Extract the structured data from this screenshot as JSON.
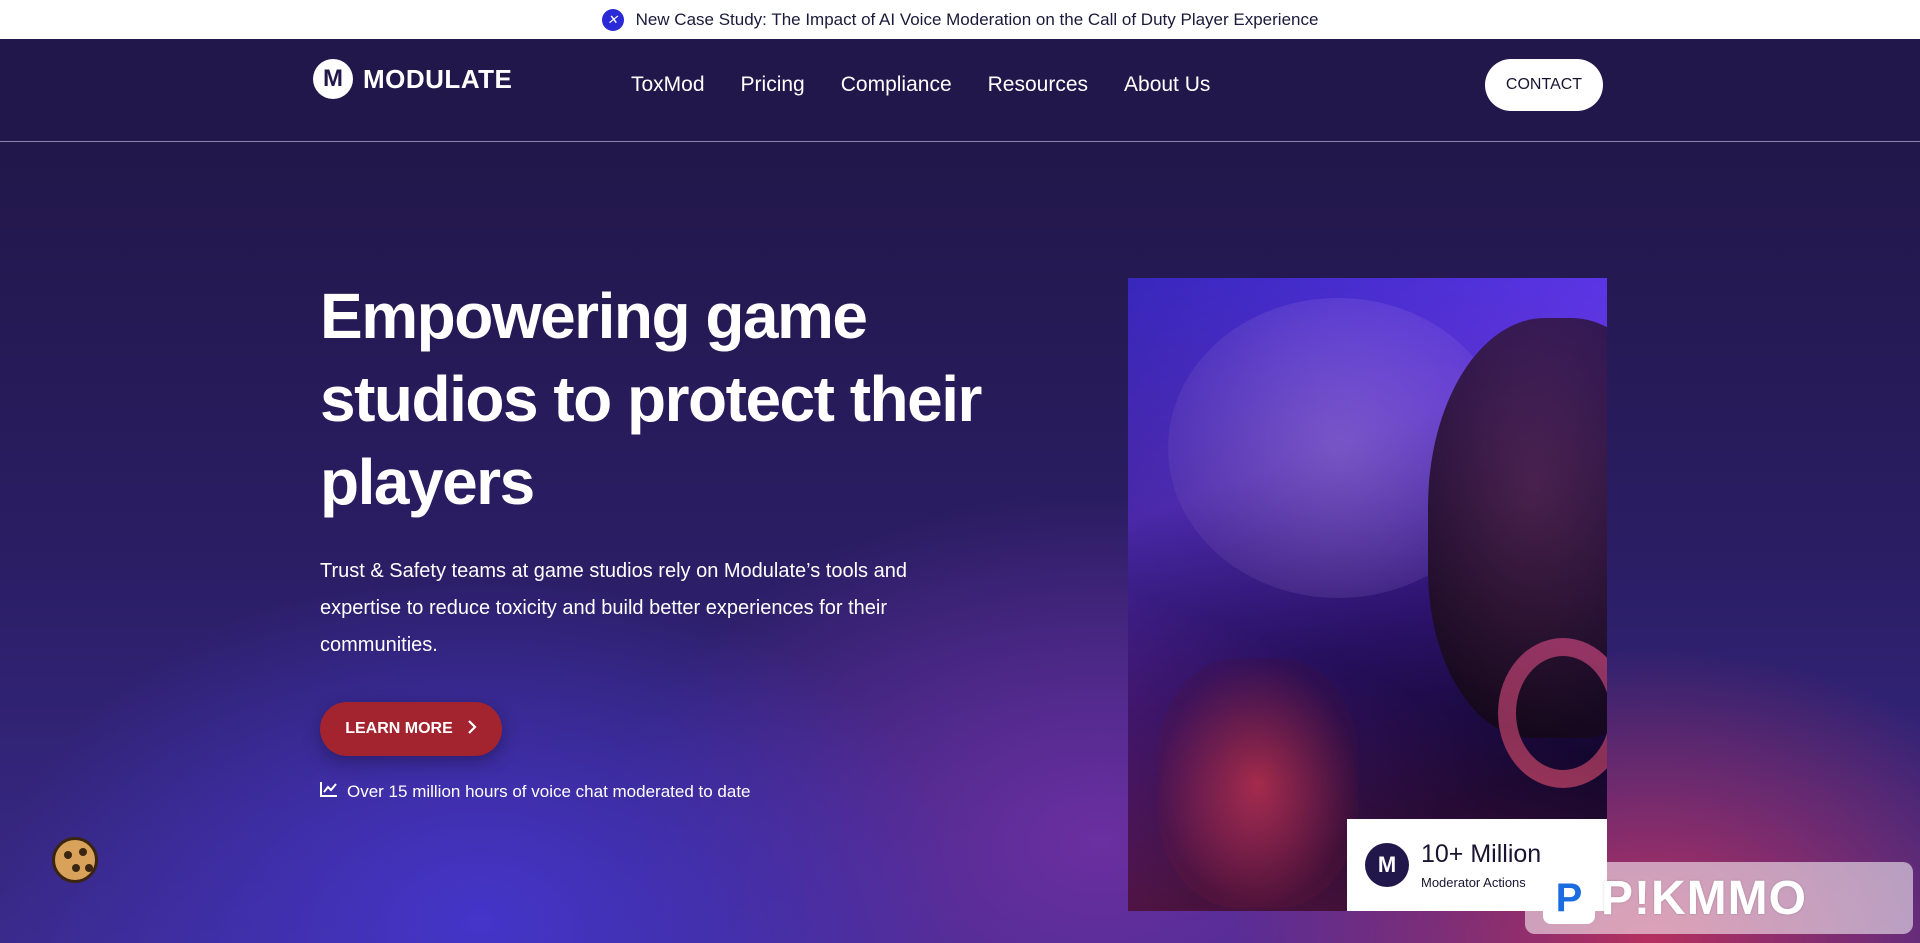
{
  "announcement": {
    "badge_icon": "x-circle-icon",
    "text": "New Case Study: The Impact of AI Voice Moderation on the Call of Duty Player Experience"
  },
  "nav": {
    "logo_text": "MODULATE",
    "logo_mark": "M",
    "items": [
      "ToxMod",
      "Pricing",
      "Compliance",
      "Resources",
      "About Us"
    ],
    "contact_label": "CONTACT"
  },
  "hero": {
    "headline": "Empowering game studios to protect their players",
    "subtext": "Trust & Safety teams at game studios rely on Modulate’s tools and expertise to reduce toxicity and build better experiences for their communities.",
    "cta_label": "LEARN MORE",
    "stat_text": "Over 15 million hours of voice chat moderated to date"
  },
  "card": {
    "mark": "M",
    "value": "10+ Million",
    "label": "Moderator Actions"
  },
  "watermark": {
    "box_letter": "P",
    "text": "P!KMMO"
  },
  "colors": {
    "nav_bg": "#22174a",
    "cta_bg": "#a3232f",
    "accent_blue": "#2a2ad6"
  }
}
